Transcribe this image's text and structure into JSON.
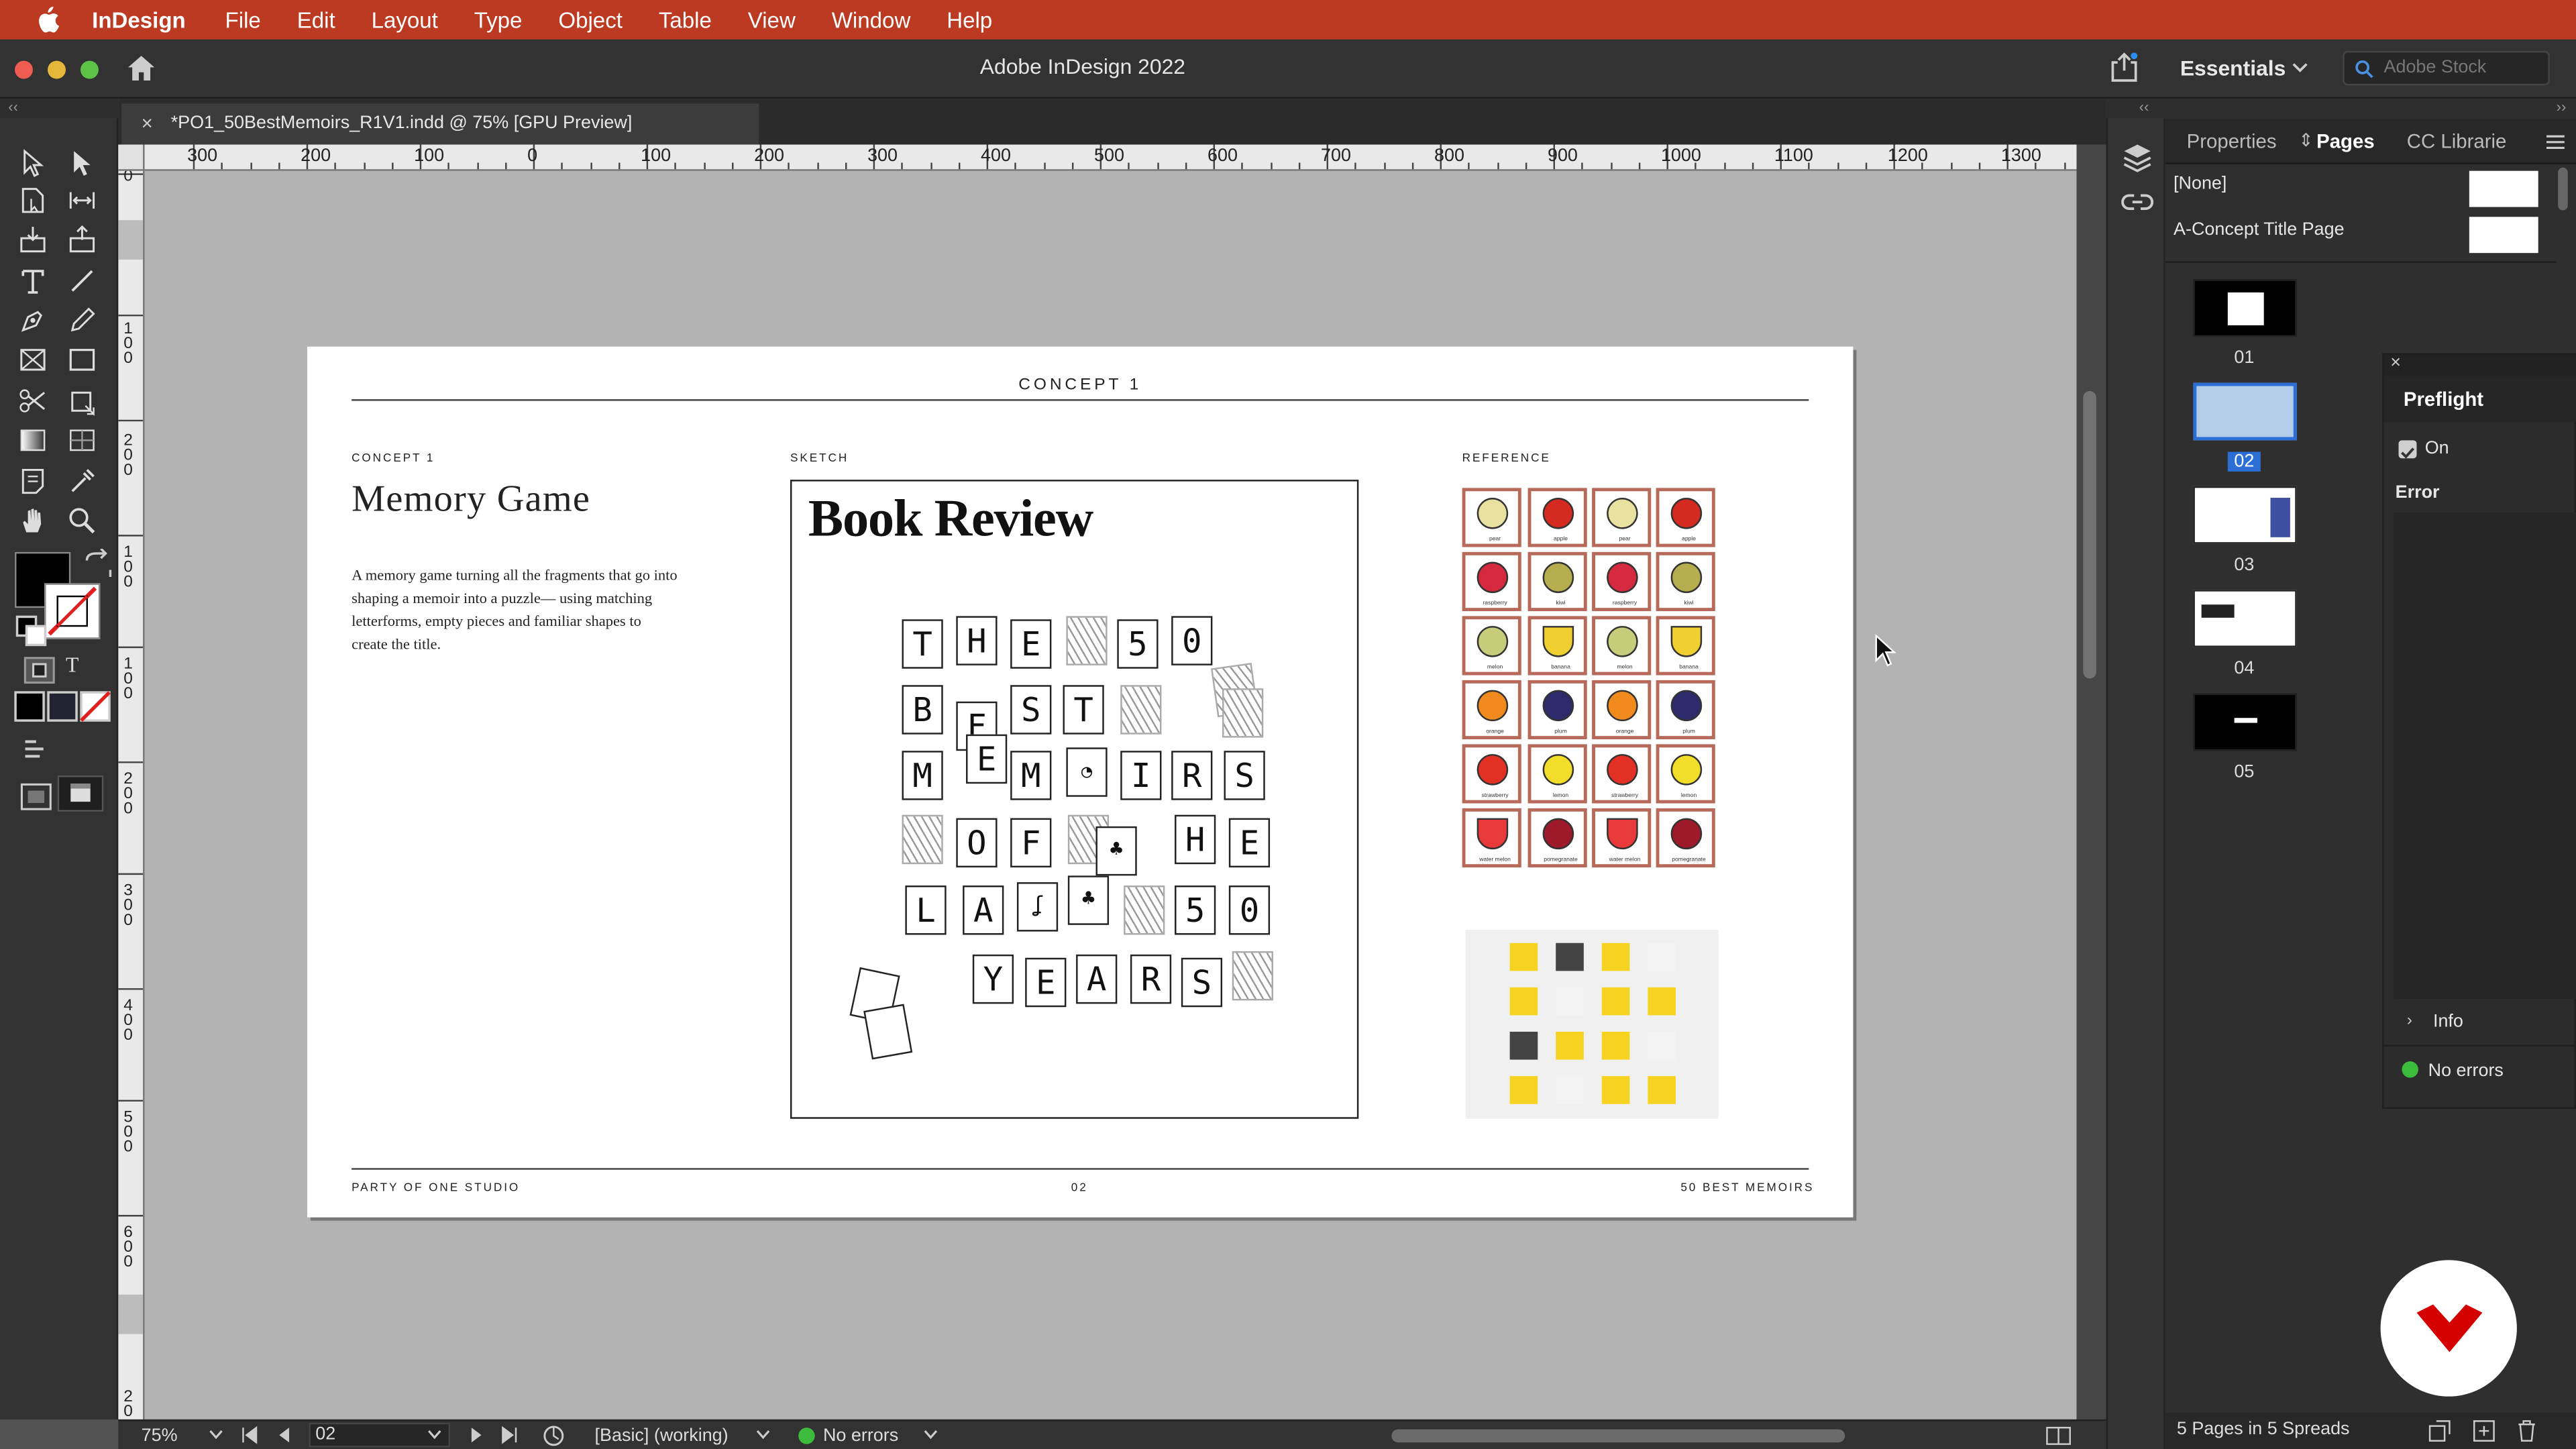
{
  "menubar": {
    "app": "InDesign",
    "items": [
      "File",
      "Edit",
      "Layout",
      "Type",
      "Object",
      "Table",
      "View",
      "Window",
      "Help"
    ]
  },
  "window": {
    "title": "Adobe InDesign 2022",
    "workspace": "Essentials",
    "stock_placeholder": "Adobe Stock"
  },
  "document_tab": {
    "label": "*PO1_50BestMemoirs_R1V1.indd @ 75% [GPU Preview]",
    "close": "×"
  },
  "rulers": {
    "horizontal": [
      "300",
      "200",
      "100",
      "0",
      "100",
      "200",
      "300",
      "400",
      "500",
      "600",
      "700",
      "800",
      "900",
      "1000",
      "1100",
      "1200",
      "1300"
    ],
    "vertical": [
      "0",
      "1 0 0",
      "2 0 0",
      "1 0 0",
      "0",
      "1 0 0",
      "2 0 0",
      "3 0 0",
      "4 0 0",
      "5 0 0",
      "6 0 0",
      "2 0"
    ]
  },
  "page": {
    "header": "CONCEPT 1",
    "left_label": "CONCEPT 1",
    "left_title": "Memory Game",
    "left_desc": "A memory game turning all the fragments that go into shaping a memoir into a puzzle— using matching letterforms, empty pieces and familiar shapes to create the title.",
    "sketch_label": "SKETCH",
    "sketch_title": "Book Review",
    "sketch_letters": [
      [
        "T",
        "H",
        "E",
        "",
        "5",
        "0"
      ],
      [
        "B",
        "F",
        "S",
        "T",
        "",
        ""
      ],
      [
        "M",
        "E",
        "M",
        "",
        "I",
        "R",
        "S"
      ],
      [
        "",
        "O",
        "F",
        "",
        "H",
        "E"
      ],
      [
        "L",
        "A",
        "",
        "",
        "5",
        "0"
      ],
      [
        "Y",
        "E",
        "A",
        "R",
        "S",
        ""
      ]
    ],
    "reference_label": "REFERENCE",
    "fruit_cards": [
      [
        "pear",
        "apple",
        "pear",
        "apple"
      ],
      [
        "raspberry",
        "kiwi",
        "raspberry",
        "kiwi"
      ],
      [
        "melon",
        "banana",
        "melon",
        "banana"
      ],
      [
        "orange",
        "plum",
        "orange",
        "plum"
      ],
      [
        "strawberry",
        "lemon",
        "strawberry",
        "lemon"
      ],
      [
        "water melon",
        "pomegranate",
        "water melon",
        "pomegranate"
      ]
    ],
    "footer_left": "PARTY OF ONE STUDIO",
    "footer_center": "02",
    "footer_right": "50 BEST MEMOIRS"
  },
  "statusbar": {
    "zoom": "75%",
    "page": "02",
    "style": "[Basic] (working)",
    "preflight": "No errors"
  },
  "pages_panel": {
    "tabs": [
      "Properties",
      "Pages",
      "CC Librarie"
    ],
    "masters": [
      "[None]",
      "A-Concept Title Page"
    ],
    "pages": [
      "01",
      "02",
      "03",
      "04",
      "05"
    ],
    "selected_page": "02",
    "footer": "5 Pages in 5 Spreads"
  },
  "preflight_panel": {
    "title": "Preflight",
    "on_label": "On",
    "error_label": "Error",
    "info_label": "Info",
    "status": "No errors"
  },
  "colors": {
    "menubar": "#bd3a22",
    "chrome": "#323232",
    "selection": "#2b6fd6",
    "ok_green": "#3dbb3d",
    "brand_red": "#d40000"
  }
}
